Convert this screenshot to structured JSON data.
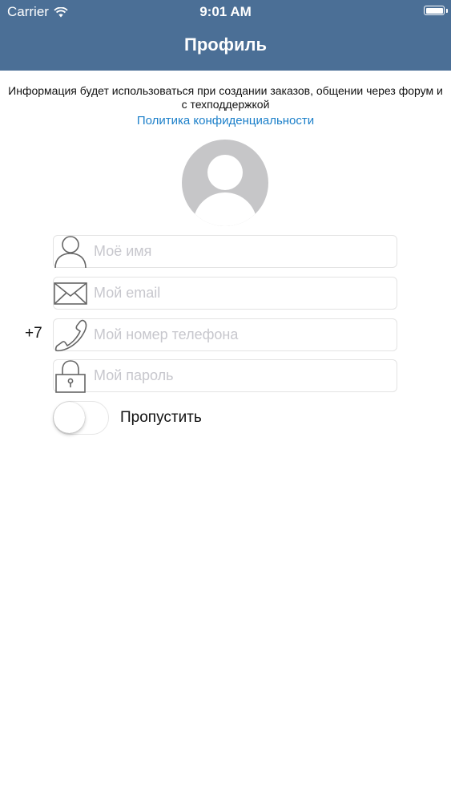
{
  "status_bar": {
    "carrier": "Carrier",
    "time": "9:01 AM"
  },
  "header": {
    "title": "Профиль",
    "background_color": "#4b6f96"
  },
  "info": {
    "text": "Информация будет использоваться при создании заказов, общении через форум и с техподдержкой",
    "privacy_link": "Политика конфиденциальности",
    "link_color": "#1b7fc9"
  },
  "form": {
    "name": {
      "placeholder": "Моё имя",
      "value": "",
      "icon": "person-icon"
    },
    "email": {
      "placeholder": "Мой email",
      "value": "",
      "icon": "envelope-icon"
    },
    "phone": {
      "prefix": "+7",
      "placeholder": "Мой номер телефона",
      "value": "",
      "icon": "phone-icon"
    },
    "password": {
      "placeholder": "Мой пароль",
      "value": "",
      "icon": "lock-icon"
    }
  },
  "skip": {
    "label": "Пропустить",
    "enabled": false
  }
}
